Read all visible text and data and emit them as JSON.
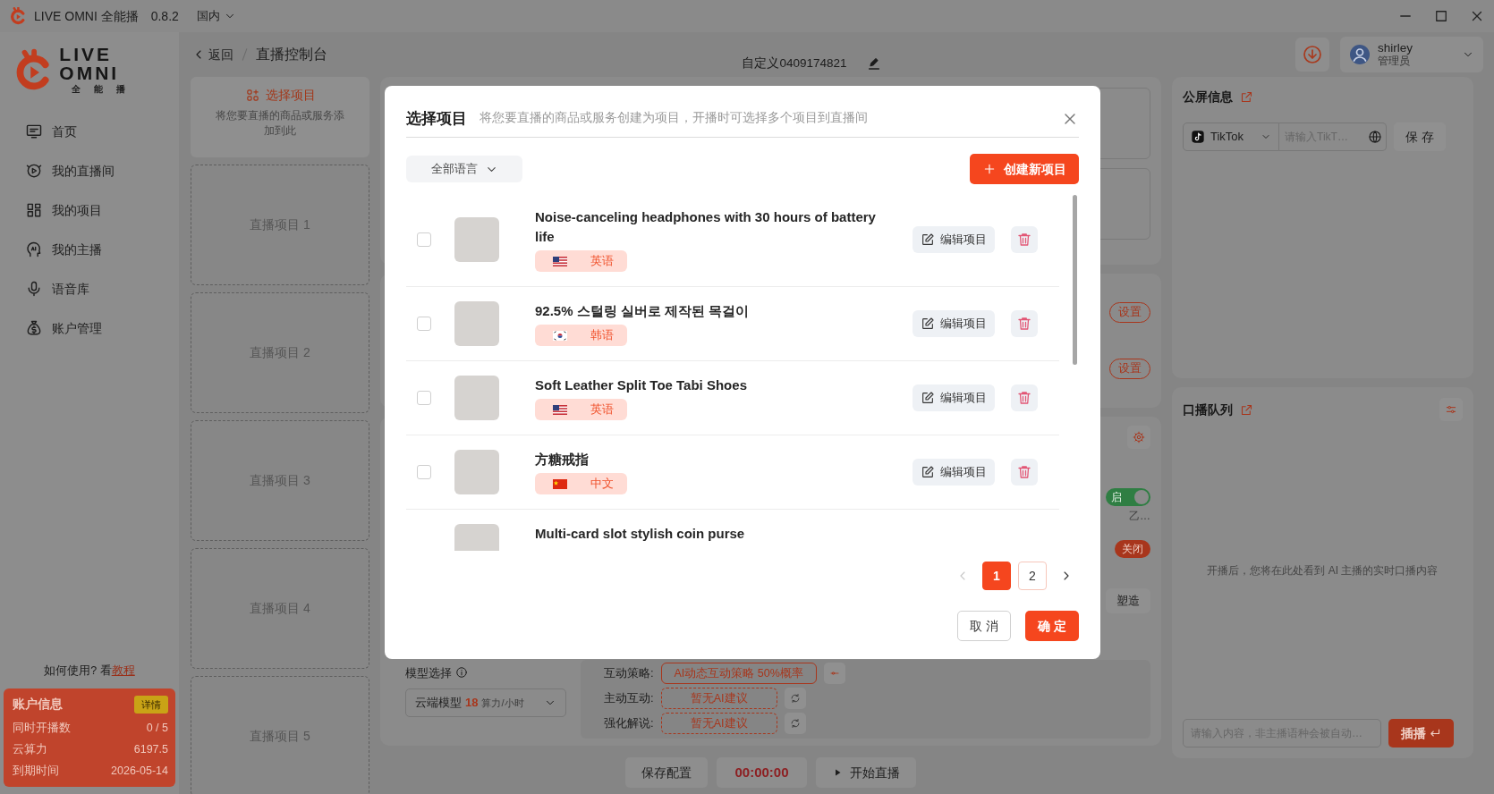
{
  "app_bar": {
    "title": "LIVE OMNI 全能播",
    "version": "0.8.2",
    "region": "国内"
  },
  "sidebar": {
    "logo_text": "LIVE OMNI",
    "logo_subtitle": "全 能 播",
    "items": [
      {
        "kind": "screen",
        "label": "首页"
      },
      {
        "kind": "live",
        "label": "我的直播间"
      },
      {
        "kind": "grid",
        "label": "我的项目"
      },
      {
        "kind": "ai",
        "label": "我的主播"
      },
      {
        "kind": "mic",
        "label": "语音库"
      },
      {
        "kind": "money",
        "label": "账户管理"
      }
    ],
    "help_text": "如何使用? 看",
    "help_link": "教程",
    "account": {
      "title": "账户信息",
      "badge": "详情",
      "rows": [
        {
          "label": "同时开播数",
          "value": "0 / 5"
        },
        {
          "label": "云算力",
          "value": "6197.5"
        },
        {
          "label": "到期时间",
          "value": "2026-05-14"
        }
      ]
    }
  },
  "header": {
    "back": "返回",
    "breadcrumb": "直播控制台",
    "session_name": "自定义0409174821",
    "user": {
      "name": "shirley",
      "role": "管理员"
    }
  },
  "project_column": {
    "select_title": "选择项目",
    "select_hint": "将您要直播的商品或服务添加到此",
    "slots": [
      "直播项目 1",
      "直播项目 2",
      "直播项目 3",
      "直播项目 4",
      "直播项目 5"
    ]
  },
  "control_panels": {
    "settings_buttons": [
      "设置",
      "设置"
    ],
    "toggle": {
      "label": "启",
      "on": true
    },
    "toggle_note": "乙…",
    "status_tag": "关闭",
    "shape_button": "塑造",
    "model": {
      "label": "模型选择",
      "value": "云端模型",
      "cost": "18",
      "unit": "算力/小时"
    },
    "strategies": [
      {
        "kind": "setting",
        "label": "互动策略:",
        "value": "AI动态互动策略 50%概率"
      },
      {
        "kind": "suggestion",
        "label": "主动互动:",
        "value": "暂无AI建议"
      },
      {
        "kind": "suggestion",
        "label": "强化解说:",
        "value": "暂无AI建议"
      }
    ]
  },
  "bottom_bar": {
    "save": "保存配置",
    "timer": "00:00:00",
    "start": "开始直播"
  },
  "public_screen": {
    "title": "公屏信息",
    "platform": "TikTok",
    "placeholder": "请输入TikT…",
    "save": "保 存"
  },
  "queue": {
    "title": "口播队列",
    "empty_text": "开播后，您将在此处看到 AI 主播的实时口播内容",
    "placeholder": "请输入内容，非主播语种会被自动…",
    "insert": "插播"
  },
  "modal": {
    "title": "选择项目",
    "subtitle": "将您要直播的商品或服务创建为项目，开播时可选择多个项目到直播间",
    "language_filter": "全部语言",
    "create": "创建新项目",
    "items": [
      {
        "checked": false,
        "title": "Noise-canceling headphones with 30 hours of battery life",
        "tag": {
          "kind": "us",
          "label": "英语"
        },
        "edit_label": "编辑项目"
      },
      {
        "checked": false,
        "title": "92.5% 스털링 실버로 제작된 목걸이",
        "tag": {
          "kind": "kr",
          "label": "韩语"
        },
        "edit_label": "编辑项目"
      },
      {
        "checked": false,
        "title": "Soft Leather Split Toe Tabi Shoes",
        "tag": {
          "kind": "us",
          "label": "英语"
        },
        "edit_label": "编辑项目"
      },
      {
        "checked": false,
        "title": "方糖戒指",
        "tag": {
          "kind": "cn",
          "label": "中文"
        },
        "edit_label": "编辑项目"
      },
      {
        "title": "Multi-card slot stylish coin purse"
      }
    ],
    "prev_disabled": true,
    "pages": [
      {
        "label": "1",
        "selected": true
      },
      {
        "label": "2",
        "selected": false
      }
    ],
    "cancel": "取 消",
    "confirm": "确 定"
  }
}
